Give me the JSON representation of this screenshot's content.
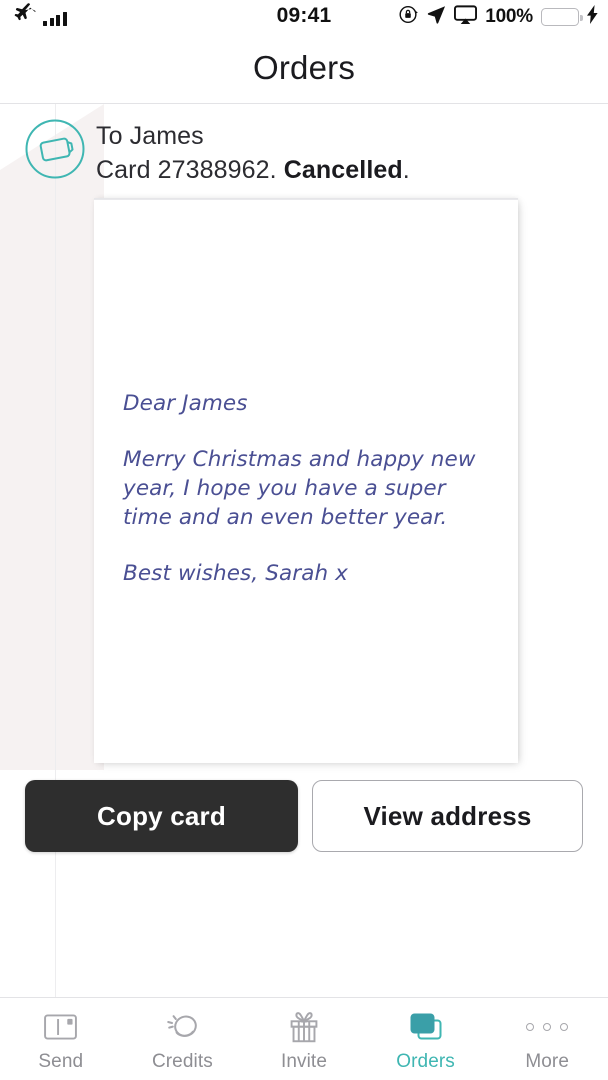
{
  "status_bar": {
    "airplane_icon": "airplane-icon",
    "signal_icon": "signal-bars-icon",
    "time": "09:41",
    "rotation_lock_icon": "rotation-lock-icon",
    "location_icon": "location-arrow-icon",
    "airplay_icon": "airplay-icon",
    "battery_percent": "100%",
    "battery_icon": "battery-icon",
    "charging_icon": "lightning-bolt-icon",
    "battery_color": "#4cd964"
  },
  "nav": {
    "title": "Orders"
  },
  "order": {
    "icon": "card-circle-icon",
    "recipient": "To James",
    "card_label": "Card 27388962.",
    "status": "Cancelled",
    "status_suffix": ".",
    "icon_color": "#3fb6b2"
  },
  "card": {
    "greeting": "Dear James",
    "body": "Merry Christmas and happy new year, I hope you have a super time and an even better year.",
    "signoff": "Best wishes, Sarah x",
    "ink_color": "#4a4f93"
  },
  "actions": {
    "primary_label": "Copy card",
    "secondary_label": "View address"
  },
  "tabbar": {
    "accent_color": "#3fb6b2",
    "inactive_color": "#8e8e93",
    "items": [
      {
        "label": "Send",
        "icon": "postcard-icon",
        "active": false
      },
      {
        "label": "Credits",
        "icon": "coin-icon",
        "active": false
      },
      {
        "label": "Invite",
        "icon": "gift-icon",
        "active": false
      },
      {
        "label": "Orders",
        "icon": "stacked-cards-icon",
        "active": true
      },
      {
        "label": "More",
        "icon": "ellipsis-icon",
        "active": false
      }
    ]
  }
}
